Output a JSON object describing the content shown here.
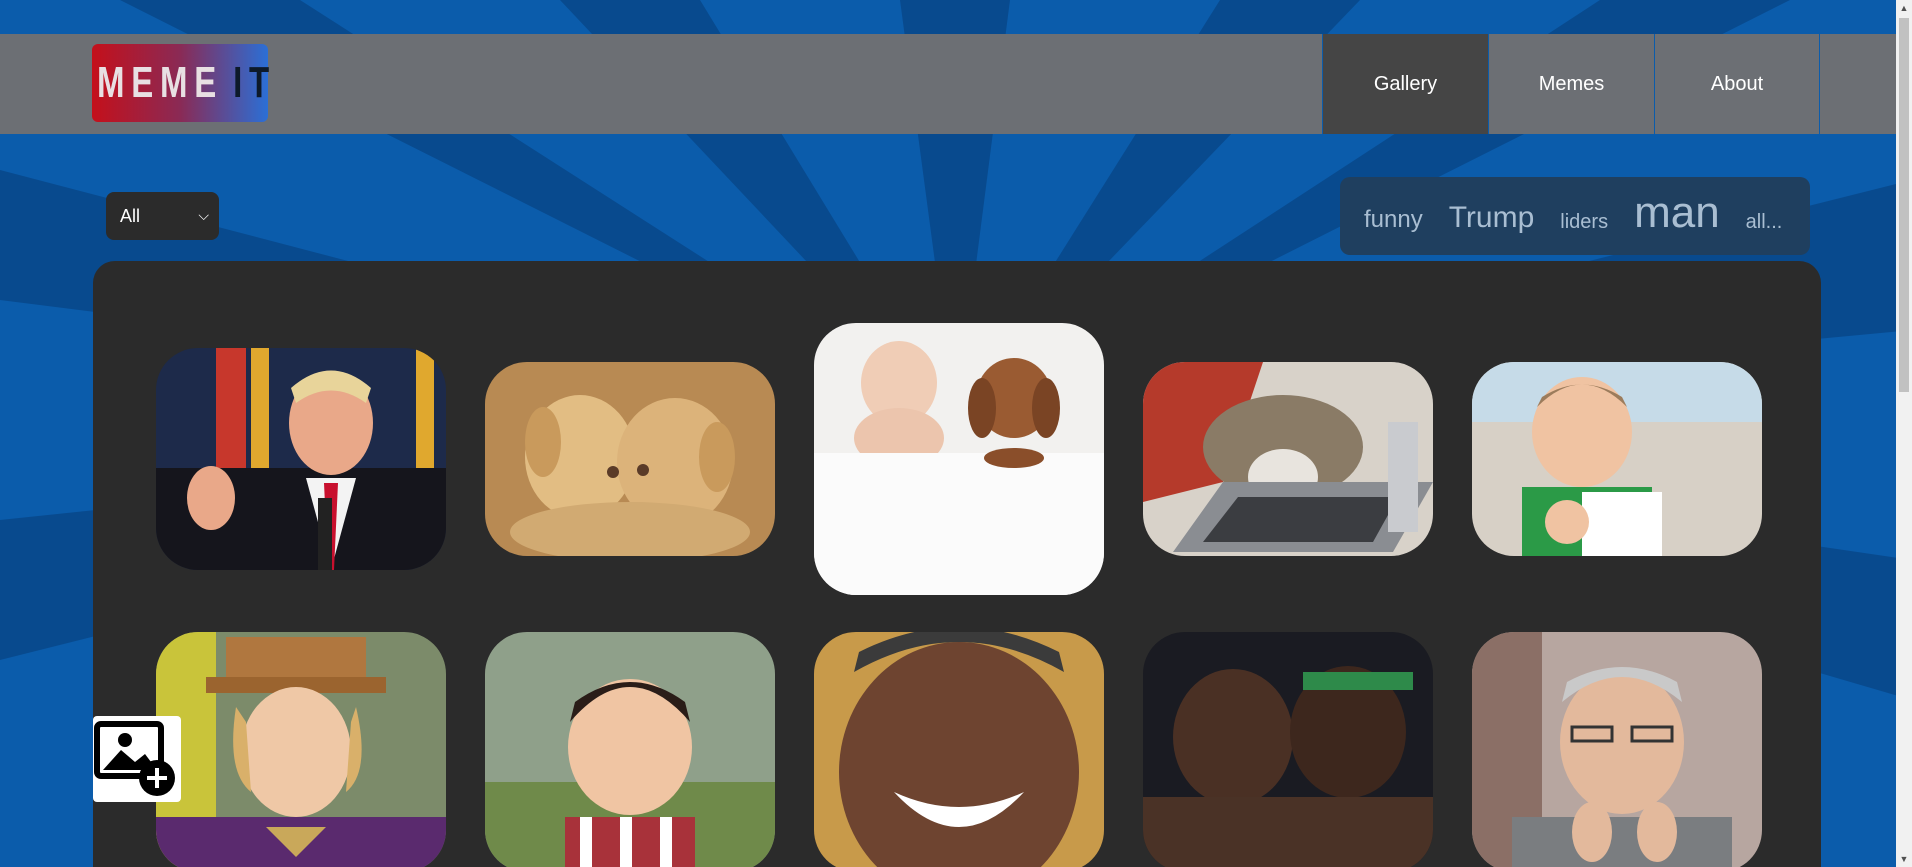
{
  "brand": {
    "logo_part1": "MEME",
    "logo_part2": "IT"
  },
  "nav": {
    "items": [
      {
        "label": "Gallery",
        "active": true
      },
      {
        "label": "Memes",
        "active": false
      },
      {
        "label": "About",
        "active": false
      }
    ]
  },
  "filter": {
    "selected": "All"
  },
  "tags": [
    "funny",
    "Trump",
    "liders",
    "man",
    "all..."
  ],
  "gallery": {
    "images": [
      {
        "subject": "trump-speech"
      },
      {
        "subject": "kissing-puppies"
      },
      {
        "subject": "baby-and-puppy-sleeping"
      },
      {
        "subject": "cat-on-laptop"
      },
      {
        "subject": "success-kid"
      },
      {
        "subject": "willy-wonka"
      },
      {
        "subject": "evil-toddler"
      },
      {
        "subject": "obama-laughing"
      },
      {
        "subject": "basketball-players-kiss"
      },
      {
        "subject": "man-pointing"
      }
    ]
  },
  "colors": {
    "background_blue": "#0b5cab",
    "header_gray": "#6c6f74",
    "active_nav": "#454545",
    "gallery_panel": "#2b2b2b",
    "tag_panel": "#1f3f5f"
  },
  "icons": {
    "upload": "add-image-icon",
    "dropdown": "chevron-down-icon"
  }
}
